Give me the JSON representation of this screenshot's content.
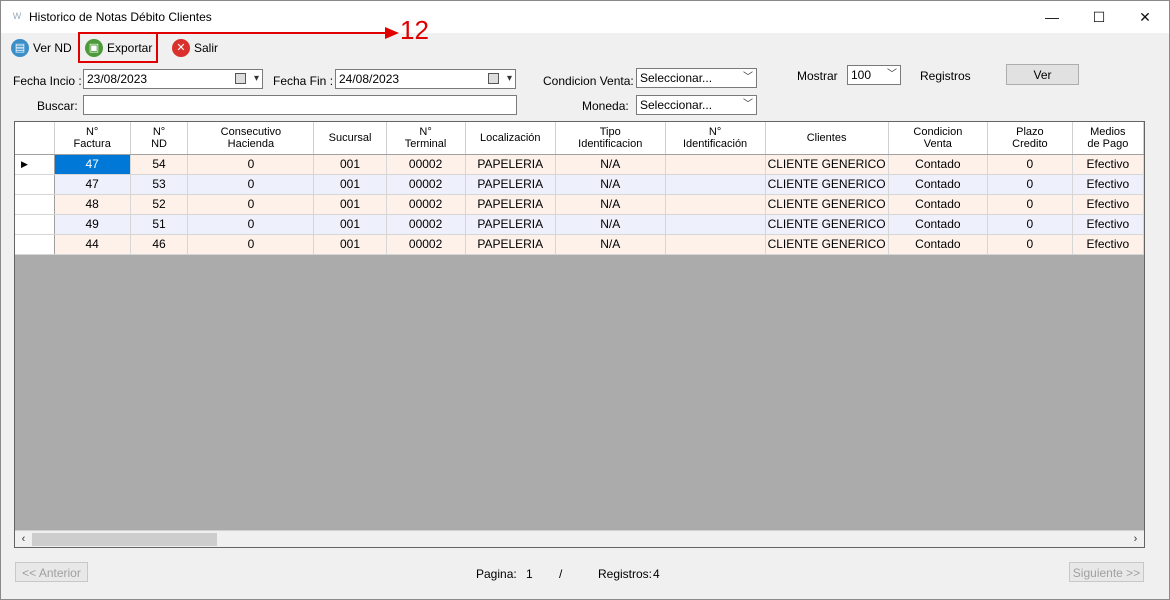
{
  "window": {
    "title": "Historico de Notas Débito Clientes",
    "min": "—",
    "max": "☐",
    "close": "✕"
  },
  "toolbar": {
    "ver_nd": "Ver ND",
    "exportar": "Exportar",
    "salir": "Salir"
  },
  "annotation": {
    "number": "12"
  },
  "filters": {
    "fecha_inicio_label": "Fecha Incio :",
    "fecha_inicio_value": "23/08/2023",
    "fecha_fin_label": "Fecha Fin :",
    "fecha_fin_value": "24/08/2023",
    "condicion_label": "Condicion Venta:",
    "condicion_value": "Seleccionar...",
    "mostrar_label": "Mostrar",
    "mostrar_value": "100",
    "registros_label": "Registros",
    "ver_button": "Ver",
    "buscar_label": "Buscar:",
    "buscar_value": "",
    "moneda_label": "Moneda:",
    "moneda_value": "Seleccionar..."
  },
  "grid": {
    "columns": [
      "N°\nFactura",
      "N°\nND",
      "Consecutivo\nHacienda",
      "Sucursal",
      "N°\nTerminal",
      "Localización",
      "Tipo\nIdentificacion",
      "N°\nIdentificación",
      "Clientes",
      "Condicion\nVenta",
      "Plazo\nCredito",
      "Medios\nde Pago"
    ],
    "rows": [
      [
        "47",
        "54",
        "0",
        "001",
        "00002",
        "PAPELERIA",
        "N/A",
        "",
        "CLIENTE GENERICO",
        "Contado",
        "0",
        "Efectivo"
      ],
      [
        "47",
        "53",
        "0",
        "001",
        "00002",
        "PAPELERIA",
        "N/A",
        "",
        "CLIENTE GENERICO",
        "Contado",
        "0",
        "Efectivo"
      ],
      [
        "48",
        "52",
        "0",
        "001",
        "00002",
        "PAPELERIA",
        "N/A",
        "",
        "CLIENTE GENERICO",
        "Contado",
        "0",
        "Efectivo"
      ],
      [
        "49",
        "51",
        "0",
        "001",
        "00002",
        "PAPELERIA",
        "N/A",
        "",
        "CLIENTE GENERICO",
        "Contado",
        "0",
        "Efectivo"
      ],
      [
        "44",
        "46",
        "0",
        "001",
        "00002",
        "PAPELERIA",
        "N/A",
        "",
        "CLIENTE GENERICO",
        "Contado",
        "0",
        "Efectivo"
      ]
    ],
    "current_row_marker": "▶"
  },
  "footer": {
    "anterior": "<< Anterior",
    "pagina_label": "Pagina:",
    "pagina_value": "1",
    "separator": "/",
    "registros_label": "Registros:",
    "registros_value": "4",
    "siguiente": "Siguiente >>"
  },
  "colors": {
    "accent": "#0078d7",
    "annotation": "#e00000",
    "row_odd": "#fdf1ea",
    "row_even": "#eef0fb",
    "grid_empty": "#ababab"
  }
}
